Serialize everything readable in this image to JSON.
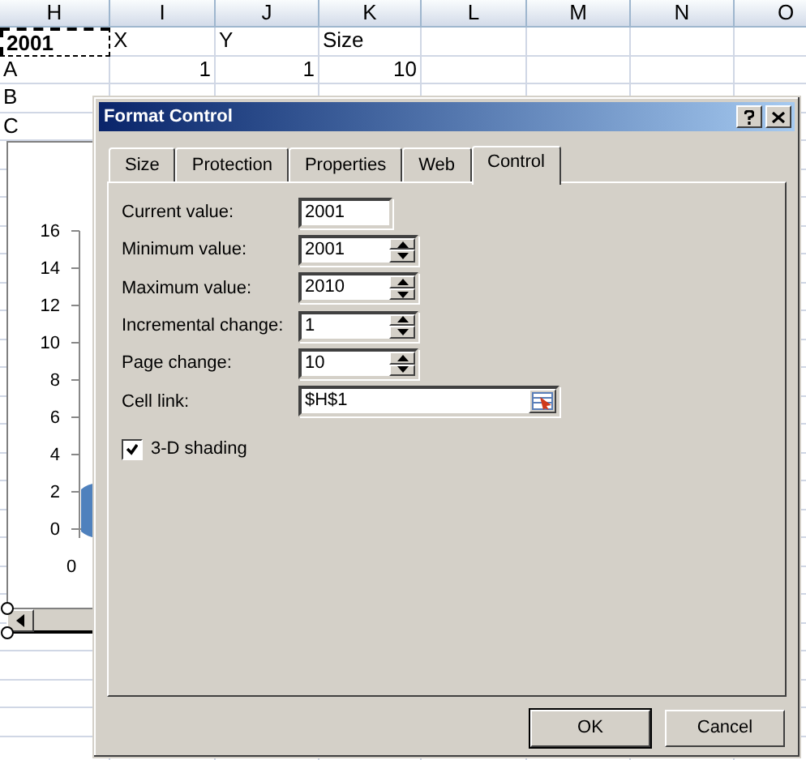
{
  "sheet": {
    "columns": [
      "H",
      "I",
      "J",
      "K",
      "L",
      "M",
      "N",
      "O"
    ],
    "rows": [
      {
        "cells": [
          {
            "text": "2001",
            "kind": "text",
            "selected": true
          },
          {
            "text": "X",
            "kind": "text",
            "selected": false
          },
          {
            "text": "Y",
            "kind": "text",
            "selected": false
          },
          {
            "text": "Size",
            "kind": "text",
            "selected": false
          }
        ]
      },
      {
        "cells": [
          {
            "text": "A",
            "kind": "text",
            "selected": false
          },
          {
            "text": "1",
            "kind": "number",
            "selected": false
          },
          {
            "text": "1",
            "kind": "number",
            "selected": false
          },
          {
            "text": "10",
            "kind": "number",
            "selected": false
          }
        ]
      },
      {
        "cells": [
          {
            "text": "B",
            "kind": "text",
            "selected": false
          }
        ]
      },
      {
        "cells": [
          {
            "text": "C",
            "kind": "text",
            "selected": false
          }
        ]
      }
    ]
  },
  "chart": {
    "y_ticks": [
      "16",
      "14",
      "12",
      "10",
      "8",
      "6",
      "4",
      "2",
      "0"
    ],
    "x_ticks": [
      "0"
    ]
  },
  "dialog": {
    "title": "Format Control",
    "tabs": [
      {
        "label": "Size",
        "selected": false
      },
      {
        "label": "Protection",
        "selected": false
      },
      {
        "label": "Properties",
        "selected": false
      },
      {
        "label": "Web",
        "selected": false
      },
      {
        "label": "Control",
        "selected": true
      }
    ],
    "fields": [
      {
        "label": "Current value:",
        "value": "2001",
        "kind": "text"
      },
      {
        "label": "Minimum value:",
        "value": "2001",
        "kind": "spin"
      },
      {
        "label": "Maximum value:",
        "value": "2010",
        "kind": "spin"
      },
      {
        "label": "Incremental change:",
        "value": "1",
        "kind": "spin"
      },
      {
        "label": "Page change:",
        "value": "10",
        "kind": "spin"
      },
      {
        "label": "Cell link:",
        "value": "$H$1",
        "kind": "ref"
      }
    ],
    "checkbox": {
      "label": "3-D shading",
      "checked": true
    },
    "buttons": [
      {
        "label": "OK",
        "default": true
      },
      {
        "label": "Cancel",
        "default": false
      }
    ]
  }
}
